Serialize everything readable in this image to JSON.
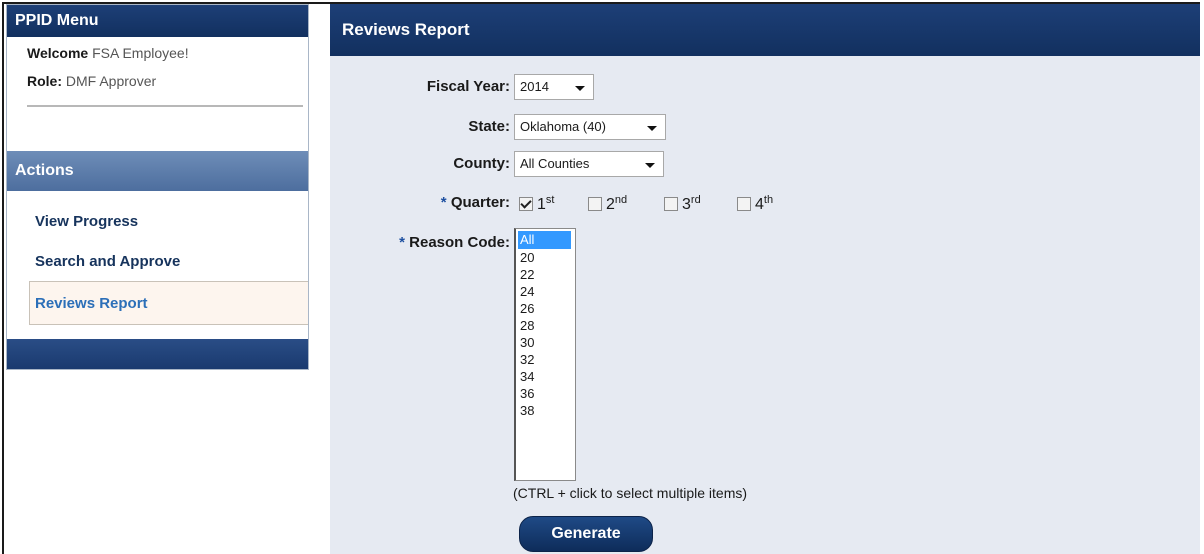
{
  "sidebar": {
    "menu_title": "PPID Menu",
    "welcome_label": "Welcome",
    "welcome_name": "FSA Employee!",
    "role_label": "Role:",
    "role_value": "DMF Approver",
    "actions_title": "Actions",
    "items": [
      {
        "label": "View Progress"
      },
      {
        "label": "Search and Approve"
      },
      {
        "label": "Reviews Report",
        "active": true
      }
    ]
  },
  "main": {
    "title": "Reviews Report",
    "fiscal_year": {
      "label": "Fiscal Year:",
      "value": "2014"
    },
    "state": {
      "label": "State:",
      "value": "Oklahoma (40)"
    },
    "county": {
      "label": "County:",
      "value": "All Counties"
    },
    "quarter": {
      "required": "*",
      "label": "Quarter:",
      "options": [
        {
          "num": "1",
          "suffix": "st",
          "checked": true
        },
        {
          "num": "2",
          "suffix": "nd",
          "checked": false
        },
        {
          "num": "3",
          "suffix": "rd",
          "checked": false
        },
        {
          "num": "4",
          "suffix": "th",
          "checked": false
        }
      ]
    },
    "reason_code": {
      "required": "*",
      "label": "Reason Code:",
      "options": [
        "All",
        "20",
        "22",
        "24",
        "26",
        "28",
        "30",
        "32",
        "34",
        "36",
        "38"
      ],
      "selected": "All"
    },
    "hint": "(CTRL + click to select multiple items)",
    "generate_label": "Generate"
  }
}
